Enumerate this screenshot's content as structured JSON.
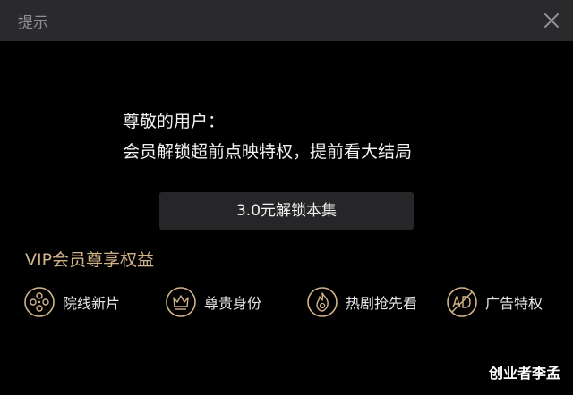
{
  "dialog": {
    "title": "提示",
    "message_line1": "尊敬的用户：",
    "message_line2": "会员解锁超前点映特权，提前看大结局",
    "unlock_button": "3.0元解锁本集"
  },
  "vip": {
    "heading": "VIP会员尊享权益",
    "benefits": [
      {
        "label": "院线新片",
        "icon": "film-reel-icon"
      },
      {
        "label": "尊贵身份",
        "icon": "crown-icon"
      },
      {
        "label": "热剧抢先看",
        "icon": "flame-icon"
      },
      {
        "label": "广告特权",
        "icon": "no-ad-icon"
      }
    ]
  },
  "watermark": "创业者李孟",
  "colors": {
    "titlebar": "#2a2a2c",
    "background": "#000000",
    "button": "#262628",
    "gold": "#d3b38a"
  }
}
